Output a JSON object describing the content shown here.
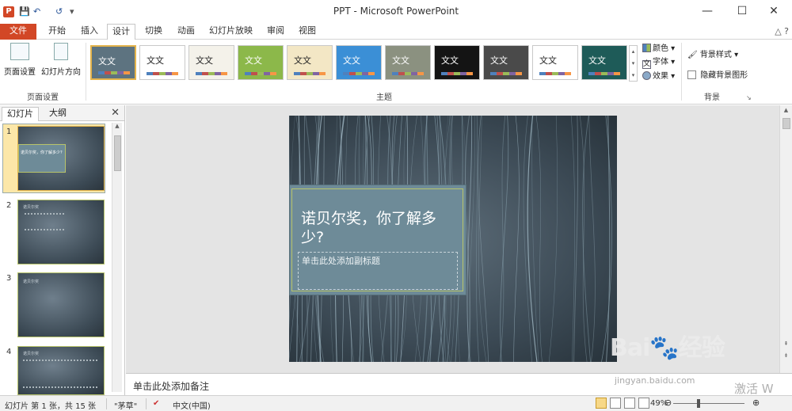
{
  "titlebar": {
    "title": "PPT - Microsoft PowerPoint",
    "app_icon_letter": "P",
    "quick_access": {
      "save": "💾",
      "undo": "↶",
      "redo": "↺",
      "more": "▾"
    },
    "minimize": "—",
    "maximize": "☐",
    "close": "✕"
  },
  "tabs": [
    {
      "label": "文件"
    },
    {
      "label": "开始"
    },
    {
      "label": "插入"
    },
    {
      "label": "设计"
    },
    {
      "label": "切换"
    },
    {
      "label": "动画"
    },
    {
      "label": "幻灯片放映"
    },
    {
      "label": "审阅"
    },
    {
      "label": "视图"
    }
  ],
  "help_icons": "△ ?",
  "ribbon": {
    "page_setup": {
      "btn_page_setup": "页面设置",
      "btn_orientation": "幻灯片方向",
      "group_label": "页面设置"
    },
    "themes": {
      "group_label": "主题",
      "tiles": [
        {
          "text": "文文",
          "bg": "#5d7380",
          "fg": "#ffffff"
        },
        {
          "text": "文文",
          "bg": "#ffffff",
          "fg": "#222222"
        },
        {
          "text": "文文",
          "bg": "#f4f2ea",
          "fg": "#222222"
        },
        {
          "text": "文文",
          "bg": "#8cb84a",
          "fg": "#ffffff"
        },
        {
          "text": "文文",
          "bg": "#f3e7c5",
          "fg": "#222222"
        },
        {
          "text": "文文",
          "bg": "#3b8fd6",
          "fg": "#ffffff"
        },
        {
          "text": "文文",
          "bg": "#8b9180",
          "fg": "#ffffff"
        },
        {
          "text": "文文",
          "bg": "#141414",
          "fg": "#ffffff"
        },
        {
          "text": "文文",
          "bg": "#4a4a4a",
          "fg": "#ffffff"
        },
        {
          "text": "文文",
          "bg": "#ffffff",
          "fg": "#222222"
        },
        {
          "text": "文文",
          "bg": "#1e5b58",
          "fg": "#ffffff"
        }
      ],
      "colors_label": "颜色",
      "fonts_label": "字体",
      "effects_label": "效果"
    },
    "background": {
      "styles_label": "背景样式",
      "hide_graphics_label": "隐藏背景图形",
      "group_label": "背景"
    }
  },
  "left_panel": {
    "tab_slides": "幻灯片",
    "tab_outline": "大纲",
    "close": "✕",
    "thumbs": [
      {
        "num": "1",
        "title": "诺贝尔奖，你了解多少?"
      },
      {
        "num": "2",
        "title": "诺贝尔奖"
      },
      {
        "num": "3",
        "title": "诺贝尔奖"
      },
      {
        "num": "4",
        "title": "诺贝尔奖"
      }
    ]
  },
  "slide": {
    "title": "诺贝尔奖，你了解多少?",
    "subtitle_placeholder": "单击此处添加副标题"
  },
  "notes": {
    "placeholder": "单击此处添加备注"
  },
  "status": {
    "slide_info": "幻灯片 第 1 张，共 15 张",
    "theme": "\"茅草\"",
    "language": "中文(中国)",
    "zoom": "49%",
    "zoom_minus": "⊖",
    "zoom_plus": "⊕"
  },
  "watermark": {
    "logo": "Bai🐾经验",
    "url": "jingyan.baidu.com",
    "activate": "激活 W"
  }
}
